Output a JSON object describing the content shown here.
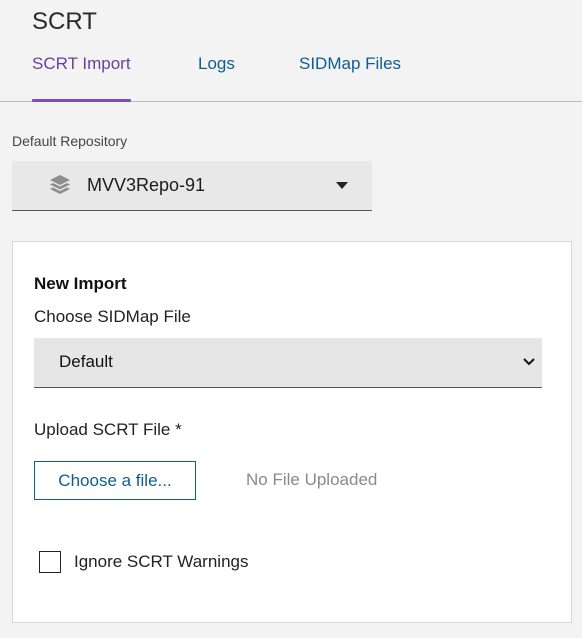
{
  "app": {
    "title": "SCRT"
  },
  "tabs": [
    {
      "label": "SCRT Import",
      "active": true
    },
    {
      "label": "Logs",
      "active": false
    },
    {
      "label": "SIDMap Files",
      "active": false
    }
  ],
  "repository": {
    "label": "Default Repository",
    "value": "MVV3Repo-91",
    "icon": "layers-icon"
  },
  "import": {
    "title": "New Import",
    "sidmap_label": "Choose SIDMap File",
    "sidmap_value": "Default",
    "upload_label": "Upload SCRT File *",
    "choose_button": "Choose a file...",
    "file_status": "No File Uploaded",
    "ignore_warnings_label": "Ignore SCRT Warnings",
    "ignore_warnings_checked": false
  },
  "colors": {
    "accent_purple": "#6b3fa0",
    "link_blue": "#0f5e8e"
  }
}
